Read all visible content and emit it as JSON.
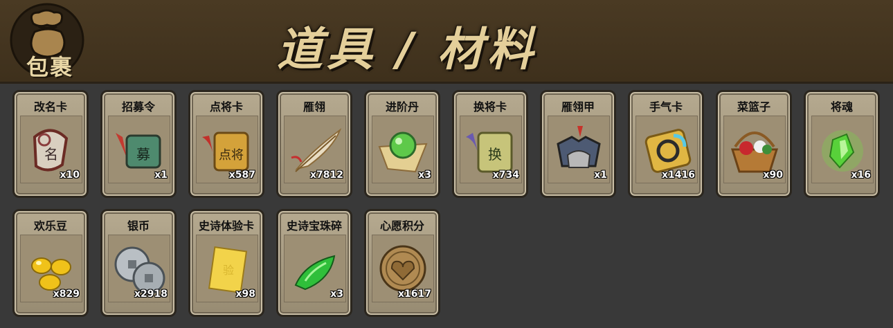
{
  "header": {
    "bag_label": "包裹",
    "title": "道具 / 材料"
  },
  "items": [
    {
      "name": "改名卡",
      "count": "x10",
      "icon": "rename-card-icon"
    },
    {
      "name": "招募令",
      "count": "x1",
      "icon": "recruit-token-icon"
    },
    {
      "name": "点将卡",
      "count": "x587",
      "icon": "general-pick-card-icon"
    },
    {
      "name": "雁翎",
      "count": "x7812",
      "icon": "feather-icon"
    },
    {
      "name": "进阶丹",
      "count": "x3",
      "icon": "advance-pill-icon"
    },
    {
      "name": "换将卡",
      "count": "x734",
      "icon": "swap-general-card-icon"
    },
    {
      "name": "雁翎甲",
      "count": "x1",
      "icon": "armor-icon"
    },
    {
      "name": "手气卡",
      "count": "x1416",
      "icon": "luck-card-icon"
    },
    {
      "name": "菜篮子",
      "count": "x90",
      "icon": "basket-icon"
    },
    {
      "name": "将魂",
      "count": "x16",
      "icon": "green-crystal-icon"
    },
    {
      "name": "欢乐豆",
      "count": "x829",
      "icon": "gold-beans-icon"
    },
    {
      "name": "银币",
      "count": "x2918",
      "icon": "silver-coins-icon"
    },
    {
      "name": "史诗体验卡",
      "count": "x98",
      "icon": "epic-trial-card-icon"
    },
    {
      "name": "史诗宝珠碎",
      "count": "x3",
      "icon": "jade-shard-icon"
    },
    {
      "name": "心愿积分",
      "count": "x1617",
      "icon": "heart-coin-icon"
    }
  ]
}
